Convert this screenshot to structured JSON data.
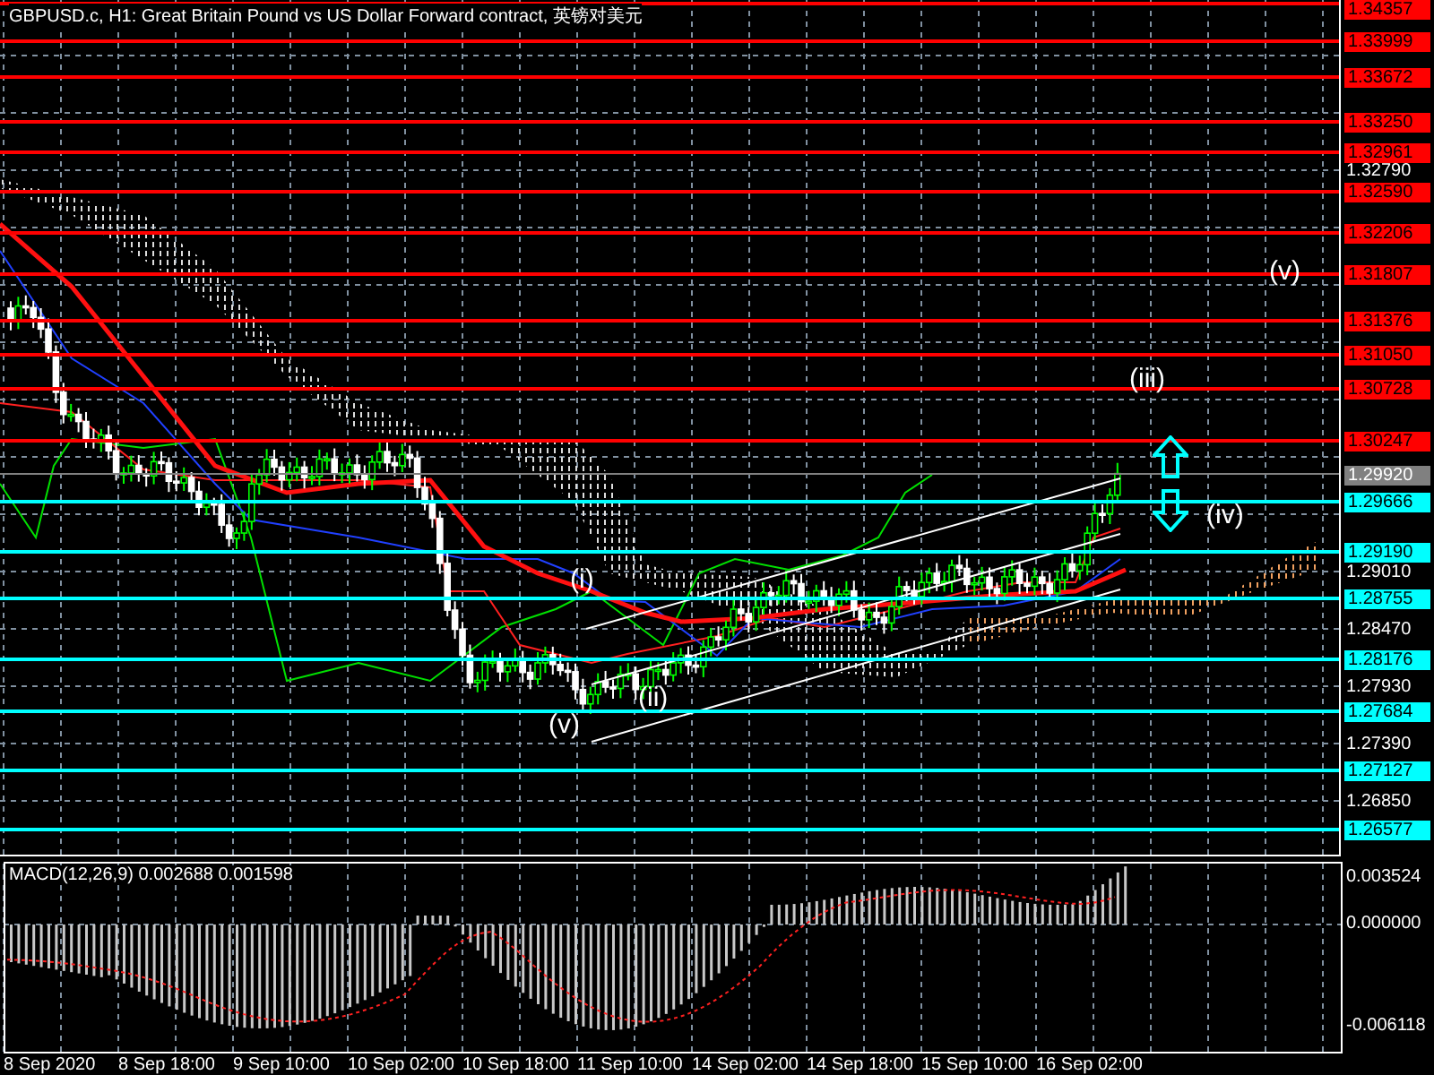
{
  "title": "GBPUSD.c, H1:  Great Britain Pound vs US Dollar Forward contract, 英镑对美元",
  "price_axis": {
    "ticks": [
      "1.32790",
      "1.29010",
      "1.28470",
      "1.27930",
      "1.27390",
      "1.26850"
    ],
    "levels": [
      {
        "price": "1.34357",
        "kind": "resistance",
        "color": "#ff0000"
      },
      {
        "price": "1.33999",
        "kind": "resistance",
        "color": "#ff0000"
      },
      {
        "price": "1.33672",
        "kind": "resistance",
        "color": "#ff0000"
      },
      {
        "price": "1.33250",
        "kind": "resistance",
        "color": "#ff0000"
      },
      {
        "price": "1.32961",
        "kind": "resistance",
        "color": "#ff0000"
      },
      {
        "price": "1.32590",
        "kind": "resistance",
        "color": "#ff0000"
      },
      {
        "price": "1.32206",
        "kind": "resistance",
        "color": "#ff0000"
      },
      {
        "price": "1.31807",
        "kind": "resistance",
        "color": "#ff0000"
      },
      {
        "price": "1.31376",
        "kind": "resistance",
        "color": "#ff0000"
      },
      {
        "price": "1.31050",
        "kind": "resistance",
        "color": "#ff0000"
      },
      {
        "price": "1.30728",
        "kind": "resistance",
        "color": "#ff0000"
      },
      {
        "price": "1.30247",
        "kind": "resistance",
        "color": "#ff0000"
      },
      {
        "price": "1.29920",
        "kind": "current",
        "color": "#808080"
      },
      {
        "price": "1.29666",
        "kind": "support",
        "color": "#00ffff"
      },
      {
        "price": "1.29190",
        "kind": "support",
        "color": "#00ffff"
      },
      {
        "price": "1.28755",
        "kind": "support",
        "color": "#00ffff"
      },
      {
        "price": "1.28176",
        "kind": "support",
        "color": "#00ffff"
      },
      {
        "price": "1.27684",
        "kind": "support",
        "color": "#00ffff"
      },
      {
        "price": "1.27127",
        "kind": "support",
        "color": "#00ffff"
      },
      {
        "price": "1.26577",
        "kind": "support",
        "color": "#00ffff"
      }
    ]
  },
  "wave_labels": [
    "(v)",
    "(iii)",
    "(iv)",
    "(i)",
    "(v)",
    "(ii)"
  ],
  "macd": {
    "title": "MACD(12,26,9) 0.002688 0.001598",
    "ticks": [
      "0.003524",
      "0.000000",
      "-0.006118"
    ]
  },
  "time_axis": [
    "8 Sep 2020",
    "8 Sep 18:00",
    "9 Sep 10:00",
    "10 Sep 02:00",
    "10 Sep 18:00",
    "11 Sep 10:00",
    "14 Sep 02:00",
    "14 Sep 18:00",
    "15 Sep 10:00",
    "16 Sep 02:00"
  ]
}
